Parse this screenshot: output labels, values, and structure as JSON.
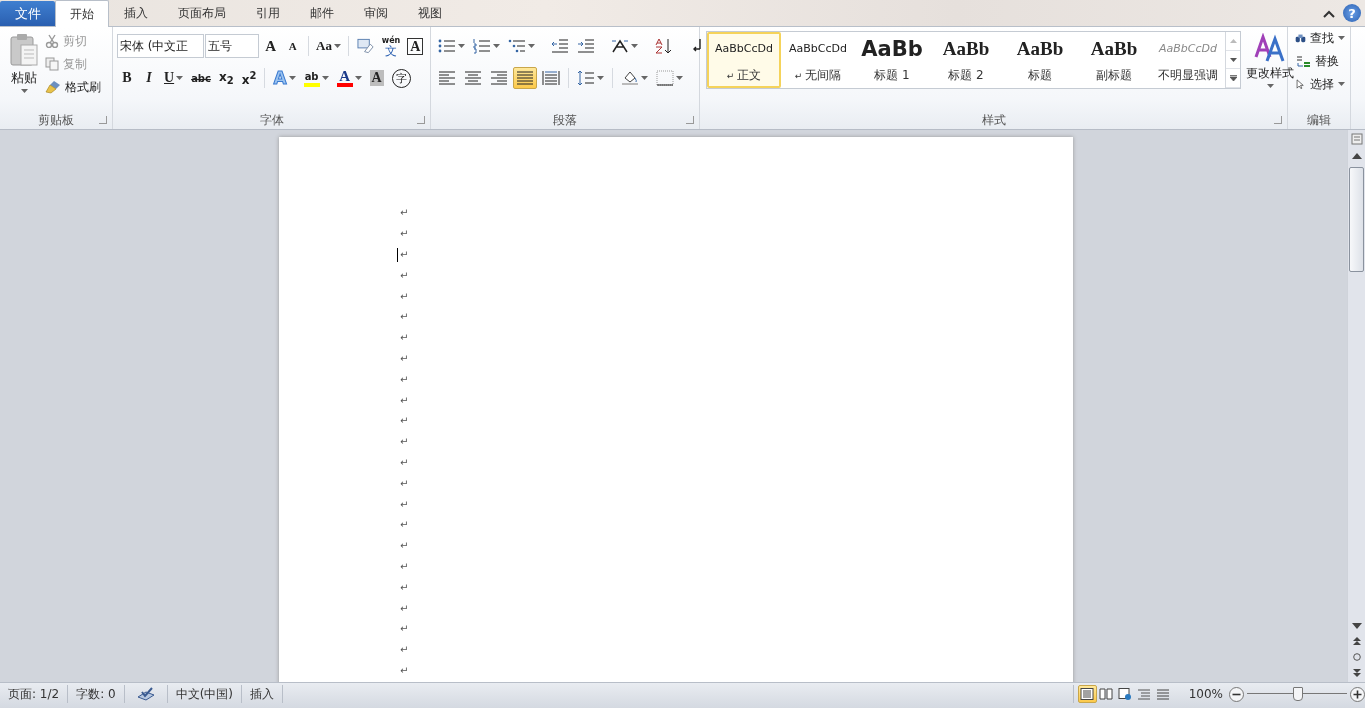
{
  "tabs": [
    {
      "label": "文件",
      "kind": "file",
      "selected": false
    },
    {
      "label": "开始",
      "kind": "tab",
      "selected": true
    },
    {
      "label": "插入",
      "kind": "tab",
      "selected": false
    },
    {
      "label": "页面布局",
      "kind": "tab",
      "selected": false
    },
    {
      "label": "引用",
      "kind": "tab",
      "selected": false
    },
    {
      "label": "邮件",
      "kind": "tab",
      "selected": false
    },
    {
      "label": "审阅",
      "kind": "tab",
      "selected": false
    },
    {
      "label": "视图",
      "kind": "tab",
      "selected": false
    }
  ],
  "help": {
    "label": "?"
  },
  "clipboard": {
    "title": "剪贴板",
    "paste": "粘贴",
    "items": [
      {
        "kind": "cut",
        "label": "剪切",
        "disabled": true
      },
      {
        "kind": "copy",
        "label": "复制",
        "disabled": true
      },
      {
        "kind": "brush",
        "label": "格式刷",
        "disabled": false
      }
    ]
  },
  "font": {
    "title": "字体",
    "font_name": "宋体 (中文正",
    "font_size": "五号",
    "row1": [
      {
        "kind": "grow",
        "label": "A",
        "dropdown": false
      },
      {
        "kind": "shrink",
        "label": "A",
        "dropdown": false
      },
      {
        "kind": "case",
        "label": "Aa",
        "dropdown": true
      },
      {
        "kind": "clear",
        "dropdown": false
      },
      {
        "kind": "ruby",
        "label": "文",
        "top": "wén",
        "dropdown": false
      },
      {
        "kind": "border",
        "label": "A",
        "dropdown": false
      }
    ],
    "row2": [
      {
        "kind": "bold",
        "label": "B",
        "dropdown": false
      },
      {
        "kind": "italic",
        "label": "I",
        "dropdown": false
      },
      {
        "kind": "underline",
        "label": "U",
        "dropdown": true
      },
      {
        "kind": "strike",
        "label": "abc",
        "dropdown": false
      },
      {
        "kind": "plain",
        "label": "x$_{2}$",
        "dropdown": false
      },
      {
        "kind": "plain",
        "label": "x$^{2}$",
        "dropdown": false
      },
      {
        "kind": "effect",
        "label": "A",
        "dropdown": true
      },
      {
        "kind": "highlight",
        "label": "ab",
        "color": "#ffff00",
        "dropdown": true
      },
      {
        "kind": "fontcolor",
        "label": "A",
        "color": "#ff0000",
        "dropdown": true
      },
      {
        "kind": "shade",
        "label": "A",
        "dropdown": false
      },
      {
        "kind": "enclose",
        "label": "字",
        "dropdown": false
      }
    ]
  },
  "paragraph": {
    "title": "段落",
    "row1": [
      {
        "kind": "bullets",
        "dropdown": true,
        "selected": false
      },
      {
        "kind": "numbering",
        "dropdown": true,
        "selected": false
      },
      {
        "kind": "multilevel",
        "dropdown": true,
        "selected": false
      },
      {
        "kind": "outdent",
        "dropdown": false,
        "selected": false
      },
      {
        "kind": "indent",
        "dropdown": false,
        "selected": false
      },
      {
        "kind": "asian",
        "dropdown": true,
        "selected": false
      },
      {
        "kind": "sort",
        "dropdown": false,
        "selected": false
      },
      {
        "kind": "marks",
        "dropdown": false,
        "selected": false
      }
    ],
    "row2": [
      {
        "kind": "left",
        "dropdown": false,
        "selected": false
      },
      {
        "kind": "center",
        "dropdown": false,
        "selected": false
      },
      {
        "kind": "right",
        "dropdown": false,
        "selected": false
      },
      {
        "kind": "justify",
        "dropdown": false,
        "selected": true
      },
      {
        "kind": "distribute",
        "dropdown": false,
        "selected": false
      },
      {
        "kind": "spacing",
        "dropdown": true,
        "selected": false
      },
      {
        "kind": "fill",
        "dropdown": true,
        "selected": false
      },
      {
        "kind": "borders",
        "dropdown": true,
        "selected": false
      }
    ]
  },
  "styles": {
    "title": "样式",
    "change_styles": "更改样式",
    "items": [
      {
        "kind": "normal",
        "preview": "AaBbCcDd",
        "name": "正文",
        "mark": "↵",
        "selected": true
      },
      {
        "kind": "normal",
        "preview": "AaBbCcDd",
        "name": "无间隔",
        "mark": "↵",
        "selected": false
      },
      {
        "kind": "heading1",
        "preview": "AaBb",
        "name": "标题 1",
        "selected": false
      },
      {
        "kind": "heading2",
        "preview": "AaBb",
        "name": "标题 2",
        "selected": false
      },
      {
        "kind": "heading2",
        "preview": "AaBb",
        "name": "标题",
        "selected": false
      },
      {
        "kind": "heading2",
        "preview": "AaBb",
        "name": "副标题",
        "selected": false
      },
      {
        "kind": "subtle",
        "preview": "AaBbCcDd",
        "name": "不明显强调",
        "selected": false
      }
    ]
  },
  "editing": {
    "title": "编辑",
    "items": [
      {
        "kind": "find",
        "label": "查找",
        "dropdown": true
      },
      {
        "kind": "replace",
        "label": "替换",
        "dropdown": false
      },
      {
        "kind": "select",
        "label": "选择",
        "dropdown": true
      }
    ]
  },
  "document": {
    "lines": [
      {
        "mark": "↵",
        "cursor": false
      },
      {
        "mark": "↵",
        "cursor": false
      },
      {
        "mark": "↵",
        "cursor": true
      },
      {
        "mark": "↵",
        "cursor": false
      },
      {
        "mark": "↵",
        "cursor": false
      },
      {
        "mark": "↵",
        "cursor": false
      },
      {
        "mark": "↵",
        "cursor": false
      },
      {
        "mark": "↵",
        "cursor": false
      },
      {
        "mark": "↵",
        "cursor": false
      },
      {
        "mark": "↵",
        "cursor": false
      },
      {
        "mark": "↵",
        "cursor": false
      },
      {
        "mark": "↵",
        "cursor": false
      },
      {
        "mark": "↵",
        "cursor": false
      },
      {
        "mark": "↵",
        "cursor": false
      },
      {
        "mark": "↵",
        "cursor": false
      },
      {
        "mark": "↵",
        "cursor": false
      },
      {
        "mark": "↵",
        "cursor": false
      },
      {
        "mark": "↵",
        "cursor": false
      },
      {
        "mark": "↵",
        "cursor": false
      },
      {
        "mark": "↵",
        "cursor": false
      },
      {
        "mark": "↵",
        "cursor": false
      },
      {
        "mark": "↵",
        "cursor": false
      },
      {
        "mark": "↵",
        "cursor": false
      }
    ]
  },
  "status_bar": {
    "page": "页面: 1/2",
    "words": "字数: 0",
    "language": "中文(中国)",
    "mode": "插入",
    "views": [
      {
        "kind": "print",
        "selected": true
      },
      {
        "kind": "reading",
        "selected": false
      },
      {
        "kind": "web",
        "selected": false
      },
      {
        "kind": "outline",
        "selected": false
      },
      {
        "kind": "draft",
        "selected": false
      }
    ],
    "zoom": "100%",
    "zoom_slider": {
      "level": 0.5
    }
  }
}
